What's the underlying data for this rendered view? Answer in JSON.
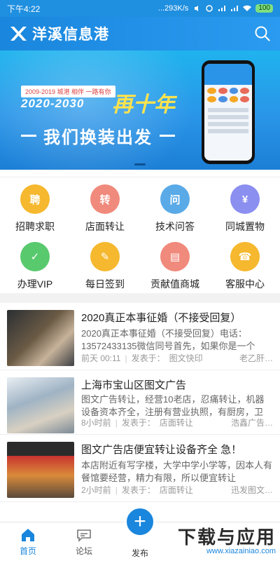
{
  "status_bar": {
    "time": "下午4:22",
    "network_speed": "...293K/s",
    "battery": "100"
  },
  "header": {
    "title": "洋溪信息港"
  },
  "banner": {
    "tag": "2009-2019 城港 相伴 一路有你",
    "years": "2020-2030",
    "slogan_right": "再十年",
    "slogan_main": "我们换装出发"
  },
  "grid": {
    "items": [
      {
        "label": "招聘求职",
        "icon": "recruit-icon",
        "glyph": "聘",
        "color": "#f5b82e"
      },
      {
        "label": "店面转让",
        "icon": "transfer-icon",
        "glyph": "转",
        "color": "#f08a7c"
      },
      {
        "label": "技术问答",
        "icon": "qa-icon",
        "glyph": "问",
        "color": "#5aaae8"
      },
      {
        "label": "同城置物",
        "icon": "yuan-icon",
        "glyph": "¥",
        "color": "#8b8ff0"
      },
      {
        "label": "办理VIP",
        "icon": "vip-icon",
        "glyph": "✓",
        "color": "#59c96e"
      },
      {
        "label": "每日签到",
        "icon": "checkin-icon",
        "glyph": "✎",
        "color": "#f5b82e"
      },
      {
        "label": "贡献值商城",
        "icon": "shop-icon",
        "glyph": "▤",
        "color": "#f08a7c"
      },
      {
        "label": "客服中心",
        "icon": "service-icon",
        "glyph": "☎",
        "color": "#f5b82e"
      }
    ]
  },
  "feed": {
    "items": [
      {
        "title": "2020真正本事征婚（不接受回复）",
        "desc": "2020真正本事征婚（不接受回复）电话：13572433135微信同号首先，如果你是一个浮…",
        "time": "前天 00:11",
        "posted_in_label": "发表于：",
        "category": "图文快印",
        "author": "老乙肝…"
      },
      {
        "title": "上海市宝山区图文广告",
        "desc": "图文广告转让，经营10老店，忍痛转让，机器设备资本齐全，注册有营业执照，有厨房，卫生…",
        "time": "8小时前",
        "posted_in_label": "发表于：",
        "category": "店面转让",
        "author": "浩鑫广告…"
      },
      {
        "title": "图文广告店便宜转让设备齐全 急！",
        "desc": "本店附近有写字楼，大学中学小学等，因本人有餐馆要经营，精力有限，所以便宜转让",
        "time": "2小时前",
        "posted_in_label": "发表于：",
        "category": "店面转让",
        "author": "迅发图文…"
      }
    ]
  },
  "bottom_nav": {
    "home": "首页",
    "forum": "论坛",
    "publish": "发布"
  },
  "watermark": {
    "big": "下载与应用",
    "small": "www.xiazainiao.com"
  },
  "colors": {
    "accent": "#1a86dd"
  }
}
